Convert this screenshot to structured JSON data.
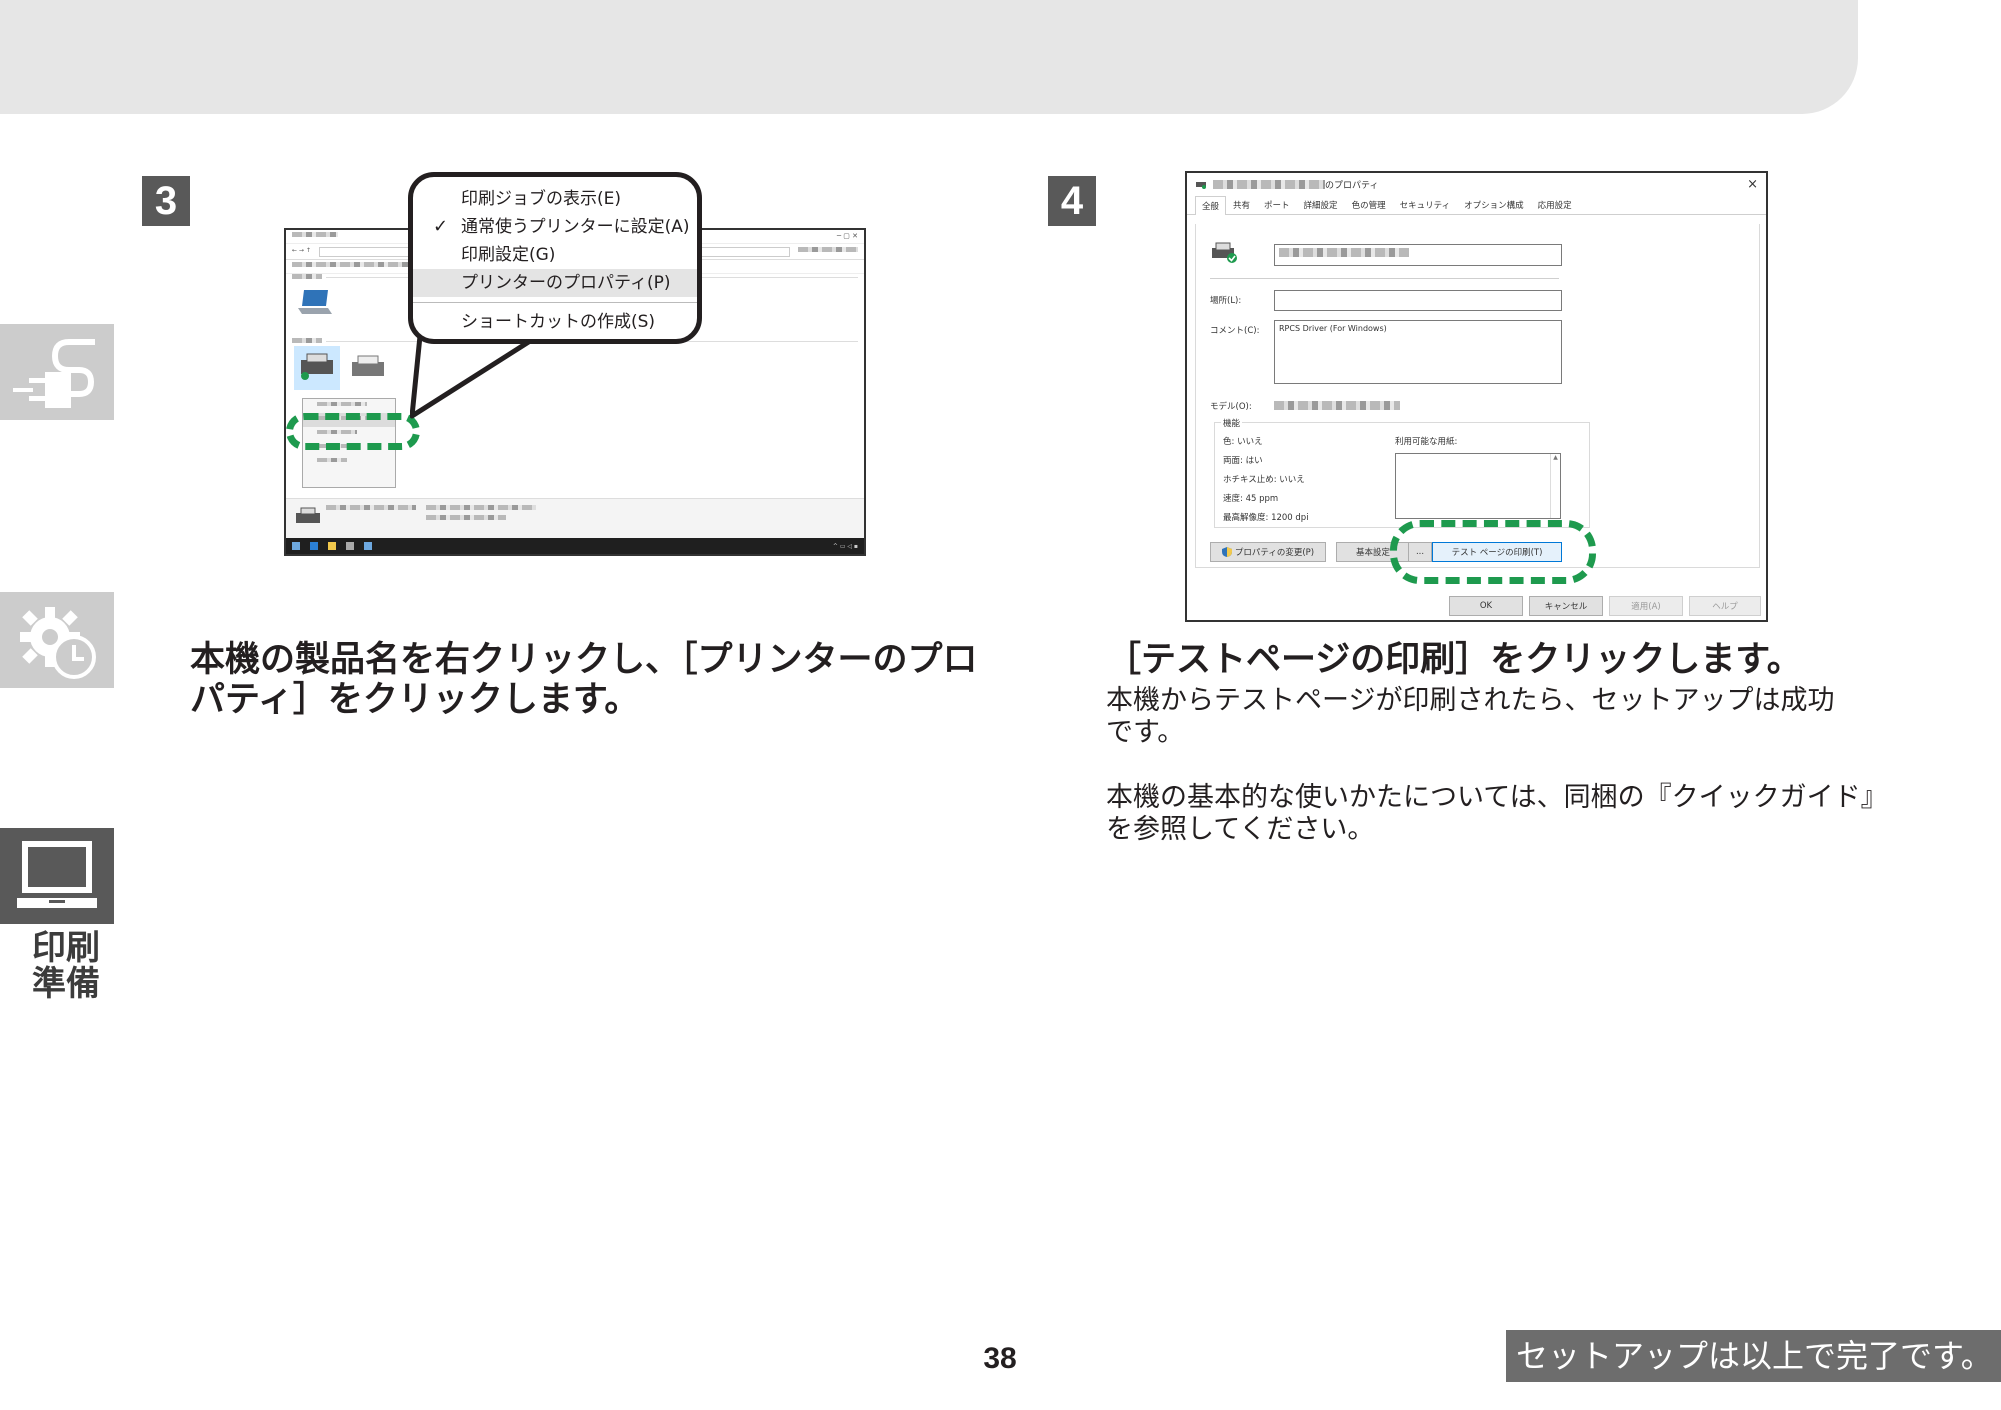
{
  "sidebar": {
    "label": "印刷\n準備",
    "label_line1": "印刷",
    "label_line2": "準備"
  },
  "step3": {
    "number": "3",
    "caption_line1": "本機の製品名を右クリックし、［プリンターのプロ",
    "caption_line2": "パティ］をクリックします。",
    "menu_items": [
      "印刷ジョブの表示(E)",
      "通常使うプリンターに設定(A)",
      "印刷設定(G)",
      "プリンターのプロパティ(P)",
      "ショートカットの作成(S)"
    ]
  },
  "step4": {
    "number": "4",
    "caption": "［テストページの印刷］をクリックします。",
    "body1_line1": "本機からテストページが印刷されたら、セットアップは成功",
    "body1_line2": "です。",
    "body2_line1": "本機の基本的な使いかたについては、同梱の『クイックガイド』",
    "body2_line2": "を参照してください。",
    "dialog": {
      "title_suffix": "のプロパティ",
      "close": "×",
      "tabs": [
        "全般",
        "共有",
        "ポート",
        "詳細設定",
        "色の管理",
        "セキュリティ",
        "オプション構成",
        "応用設定"
      ],
      "location_label": "場所(L):",
      "comment_label": "コメント(C):",
      "comment_value": "RPCS Driver (For Windows)",
      "model_label": "モデル(O):",
      "features_label": "機能",
      "features": [
        "色: いいえ",
        "両面: はい",
        "ホチキス止め: いいえ",
        "速度: 45 ppm",
        "最高解像度: 1200 dpi"
      ],
      "paper_label": "利用可能な用紙:",
      "change_props_button": "プロパティの変更(P)",
      "basic_settings_button": "基本設定",
      "ellipsis": "...",
      "test_page_button": "テスト ページの印刷(T)",
      "ok_button": "OK",
      "cancel_button": "キャンセル",
      "apply_button": "適用(A)",
      "help_button": "ヘルプ"
    }
  },
  "footer": {
    "page_number": "38",
    "complete_banner": "セットアップは以上で完了です。"
  }
}
